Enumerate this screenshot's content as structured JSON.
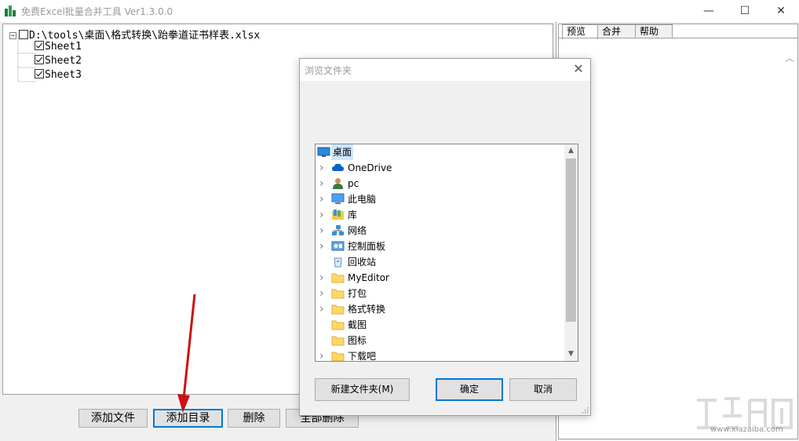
{
  "window": {
    "title": "免费Excel批量合并工具 Ver1.3.0.0",
    "minimize": "—",
    "maximize": "☐",
    "close": "✕"
  },
  "tree": {
    "root_expander": "−",
    "root_label": "D:\\tools\\桌面\\格式转换\\跆拳道证书样表.xlsx",
    "sheets": [
      "Sheet1",
      "Sheet2",
      "Sheet3"
    ]
  },
  "buttons": {
    "add_file": "添加文件",
    "add_dir": "添加目录",
    "delete": "删除",
    "delete_all": "全部删除"
  },
  "tabs": [
    "预览",
    "合并",
    "帮助"
  ],
  "right_scroll_up": "︿",
  "dialog": {
    "title": "浏览文件夹",
    "close": "✕",
    "folders": [
      {
        "label": "桌面",
        "icon": "desktop-icon",
        "chevron": false,
        "root": true,
        "selected": true
      },
      {
        "label": "OneDrive",
        "icon": "cloud-icon",
        "chevron": true
      },
      {
        "label": "pc",
        "icon": "user-icon",
        "chevron": true
      },
      {
        "label": "此电脑",
        "icon": "computer-icon",
        "chevron": true
      },
      {
        "label": "库",
        "icon": "library-icon",
        "chevron": true
      },
      {
        "label": "网络",
        "icon": "network-icon",
        "chevron": true
      },
      {
        "label": "控制面板",
        "icon": "control-panel-icon",
        "chevron": true
      },
      {
        "label": "回收站",
        "icon": "recycle-bin-icon",
        "chevron": false
      },
      {
        "label": "MyEditor",
        "icon": "folder-icon",
        "chevron": true
      },
      {
        "label": "打包",
        "icon": "folder-icon",
        "chevron": true
      },
      {
        "label": "格式转换",
        "icon": "folder-icon",
        "chevron": true
      },
      {
        "label": "截图",
        "icon": "folder-icon",
        "chevron": false
      },
      {
        "label": "图标",
        "icon": "folder-icon",
        "chevron": false
      },
      {
        "label": "下载吧",
        "icon": "folder-icon",
        "chevron": true
      }
    ],
    "new_folder": "新建文件夹(M)",
    "ok": "确定",
    "cancel": "取消",
    "scroll_up": "▲",
    "scroll_down": "▼"
  },
  "watermark": {
    "text": "www.xiazaiba.com"
  },
  "colors": {
    "accent": "#0078d7",
    "selection": "#cce8ff",
    "folder": "#ffd766",
    "arrow": "#cc1111"
  }
}
